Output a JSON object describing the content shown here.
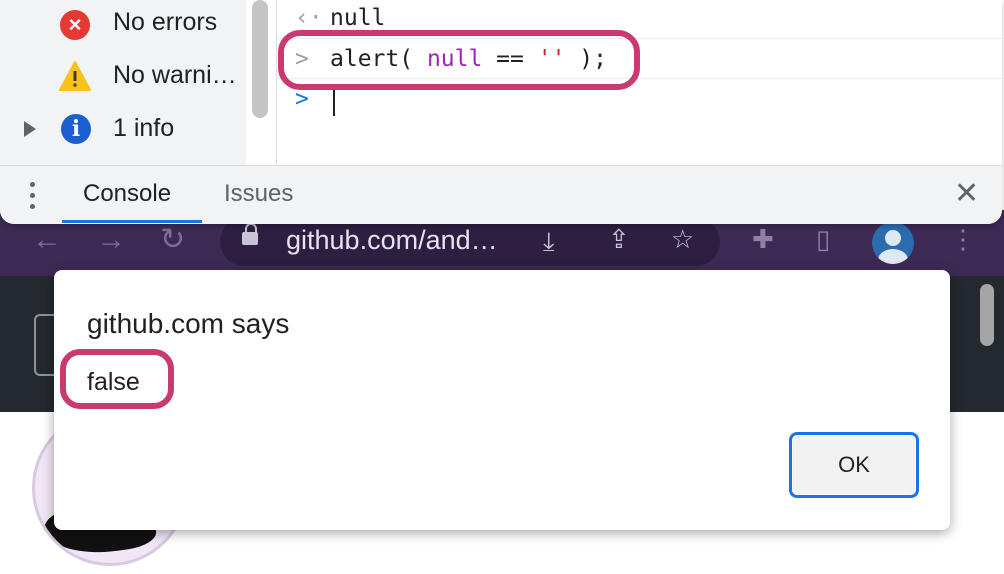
{
  "devtools": {
    "sidebar": {
      "items": [
        {
          "label": "No errors",
          "icon": "error-icon"
        },
        {
          "label": "No warni…",
          "icon": "warning-icon"
        },
        {
          "label": "1 info",
          "icon": "info-icon"
        }
      ]
    },
    "console": {
      "result_marker": "‹·",
      "result_value": "null",
      "input_marker": ">",
      "input_code": {
        "prefix": "alert( ",
        "null_token": "null",
        "operator": " == ",
        "string_token": "''",
        "suffix": " );"
      },
      "prompt_marker": ">"
    },
    "drawer": {
      "tabs": [
        "Console",
        "Issues"
      ],
      "active_tab": "Console",
      "close_label": "✕"
    }
  },
  "browser": {
    "url": "github.com/and…"
  },
  "dialog": {
    "title": "github.com says",
    "message": "false",
    "ok_label": "OK"
  },
  "colors": {
    "highlight": "#c93b70",
    "accent": "#1a73e8",
    "browser_frame": "#3c2a55"
  }
}
